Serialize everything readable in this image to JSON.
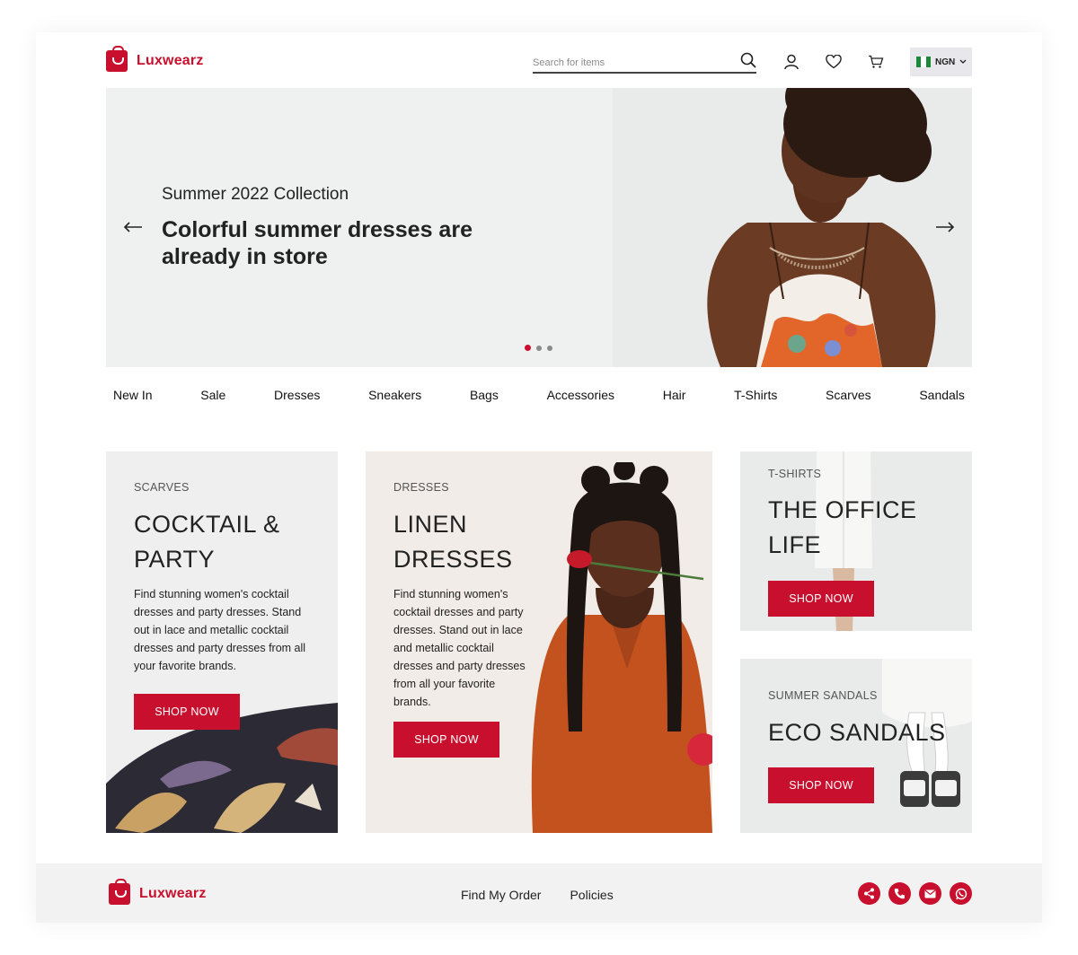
{
  "brand": {
    "name": "Luxwearz",
    "accent": "#c8102e"
  },
  "header": {
    "search_placeholder": "Search for items",
    "currency": "NGN",
    "icons": [
      "search-icon",
      "user-icon",
      "heart-icon",
      "cart-icon",
      "nigeria-flag-icon",
      "chevron-down-icon"
    ]
  },
  "hero": {
    "subtitle": "Summer 2022 Collection",
    "title": "Colorful summer dresses are already in store",
    "slide_count": 3,
    "active_slide": 1
  },
  "categories": [
    "New In",
    "Sale",
    "Dresses",
    "Sneakers",
    "Bags",
    "Accessories",
    "Hair",
    "T-Shirts",
    "Scarves",
    "Sandals"
  ],
  "promos": [
    {
      "tag": "SCARVES",
      "title_line1": "COCKTAIL &",
      "title_line2": "PARTY",
      "description": "Find stunning women's cocktail dresses and party dresses. Stand out in lace and metallic cocktail dresses and party dresses from all your favorite brands.",
      "button": "SHOP NOW"
    },
    {
      "tag": "DRESSES",
      "title_line1": "LINEN",
      "title_line2": "DRESSES",
      "description": "Find stunning women's cocktail dresses and party dresses. Stand out in lace and metallic cocktail dresses and party dresses from all your favorite brands.",
      "button": "SHOP NOW"
    },
    {
      "tag": "T-SHIRTS",
      "title_line1": "THE OFFICE",
      "title_line2": "LIFE",
      "button": "SHOP NOW"
    },
    {
      "tag": "SUMMER SANDALS",
      "title_line1": "ECO SANDALS",
      "button": "SHOP NOW"
    }
  ],
  "footer": {
    "links": [
      "Find My Order",
      "Policies"
    ],
    "socials": [
      "share-icon",
      "phone-icon",
      "mail-icon",
      "whatsapp-icon"
    ]
  }
}
